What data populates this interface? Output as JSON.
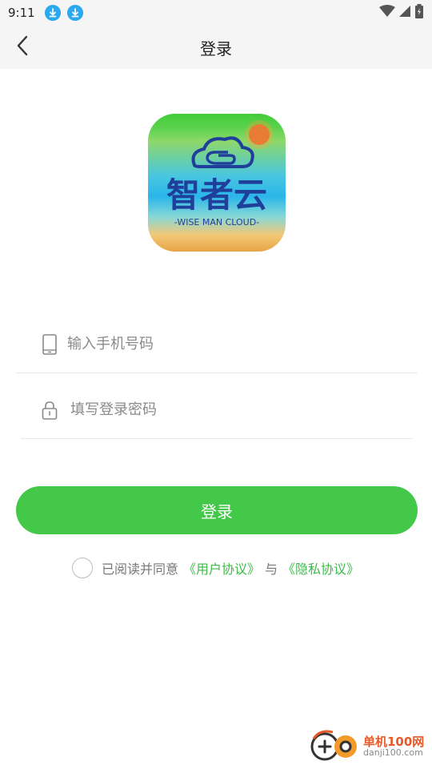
{
  "status_bar": {
    "time": "9:11",
    "notification_icons": [
      "download-icon",
      "download-icon"
    ],
    "right_icons": [
      "wifi-icon",
      "signal-icon",
      "battery-icon"
    ]
  },
  "header": {
    "title": "登录",
    "back_icon": "chevron-left-icon"
  },
  "logo": {
    "brand_cn": "智者云",
    "brand_en": "-WISE MAN CLOUD-"
  },
  "form": {
    "phone": {
      "placeholder": "输入手机号码",
      "value": "",
      "icon": "phone-icon"
    },
    "password": {
      "placeholder": "填写登录密码",
      "value": "",
      "icon": "lock-icon"
    }
  },
  "login_button": {
    "label": "登录"
  },
  "agreement": {
    "prefix": "已阅读并同意",
    "user_agreement": "《用户协议》",
    "conjunction": "与",
    "privacy_agreement": "《隐私协议》",
    "checked": false
  },
  "watermark": {
    "title": "单机100网",
    "url": "danji100.com"
  },
  "colors": {
    "accent": "#44c84a",
    "link": "#3dbb4a",
    "header_bg": "#f5f5f5",
    "status_download": "#2aa8f0"
  }
}
